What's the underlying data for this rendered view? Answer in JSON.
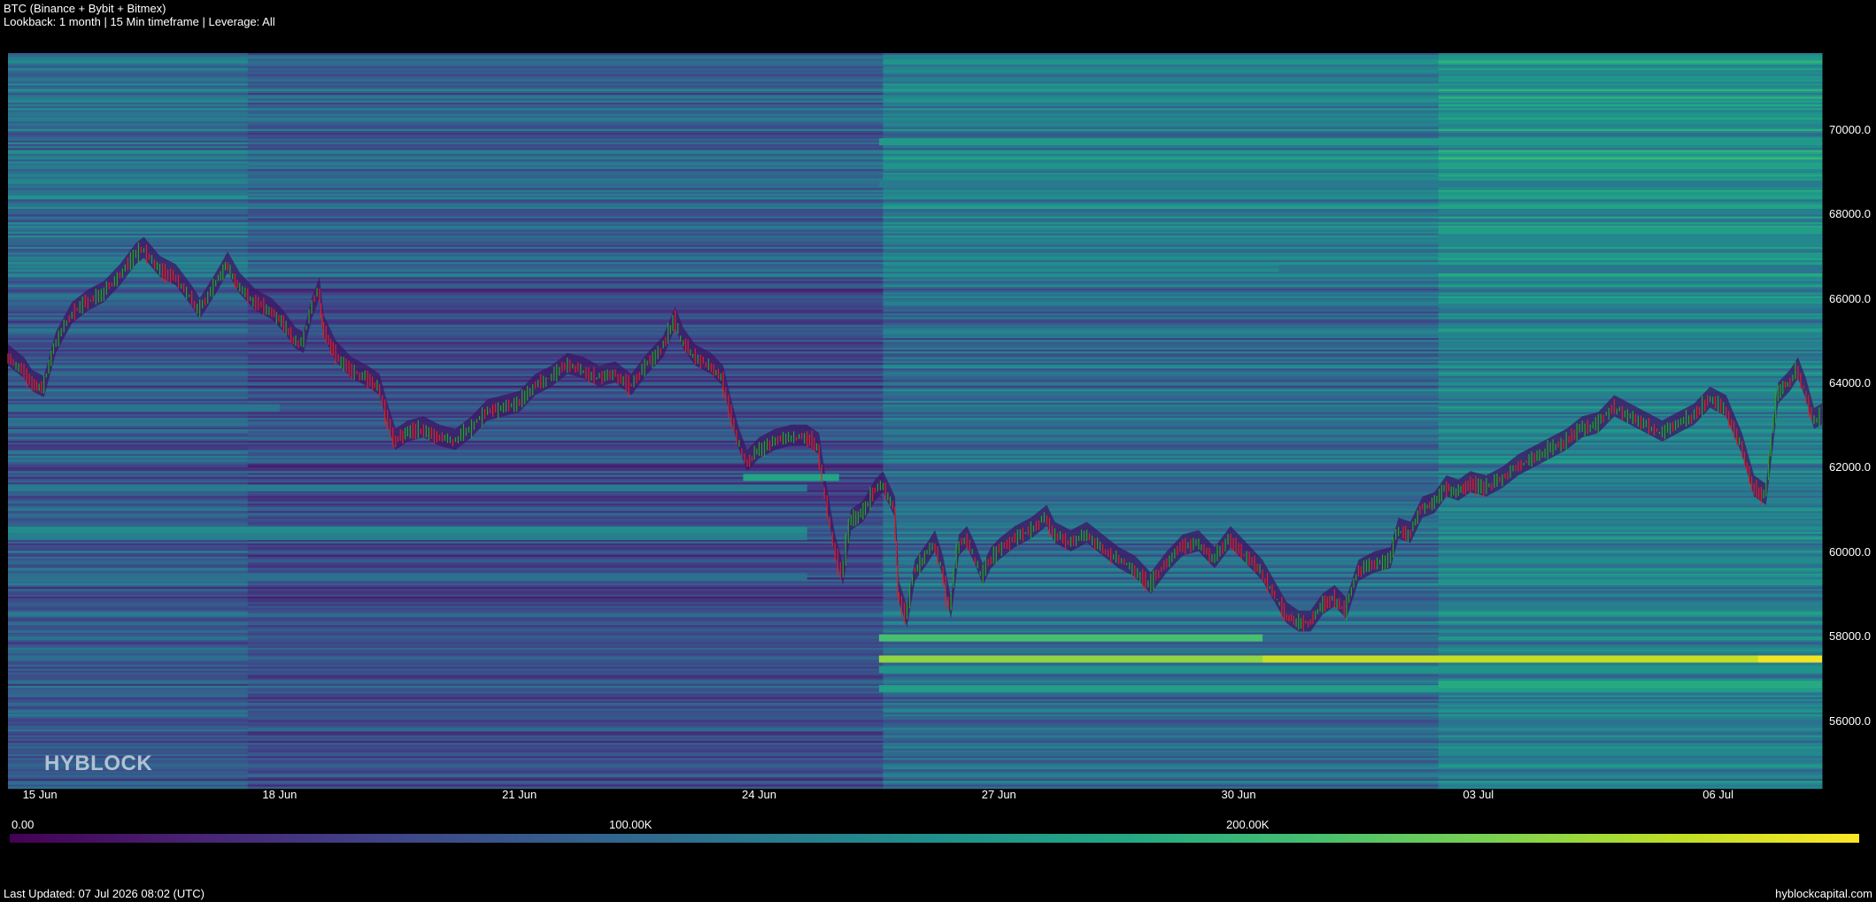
{
  "header": {
    "title": "BTC (Binance + Bybit + Bitmex)",
    "subtitle": "Lookback: 1 month | 15 Min timeframe | Leverage: All"
  },
  "watermark": "HYBLOCK",
  "footer": {
    "last_updated": "Last Updated: 07 Jul 2026 08:02 (UTC)",
    "site": "hyblockcapital.com"
  },
  "colorbar": {
    "labels": [
      "0.00",
      "100.00K",
      "200.00K"
    ],
    "min": 0,
    "max": 270000,
    "colormap": "viridis"
  },
  "chart_data": {
    "type": "heatmap",
    "subtype": "liquidation-heatmap-with-candles",
    "xlim_days": [
      14.6,
      37.3
    ],
    "ylim": [
      54400,
      71800
    ],
    "x_ticks": [
      {
        "day": 15,
        "label": "15 Jun"
      },
      {
        "day": 18,
        "label": "18 Jun"
      },
      {
        "day": 21,
        "label": "21 Jun"
      },
      {
        "day": 24,
        "label": "24 Jun"
      },
      {
        "day": 27,
        "label": "27 Jun"
      },
      {
        "day": 30,
        "label": "30 Jun"
      },
      {
        "day": 33,
        "label": "03 Jul"
      },
      {
        "day": 36,
        "label": "06 Jul"
      }
    ],
    "y_ticks": [
      56000,
      58000,
      60000,
      62000,
      64000,
      66000,
      68000,
      70000
    ],
    "y_tick_labels": [
      "56000.0",
      "58000.0",
      "60000.0",
      "62000.0",
      "64000.0",
      "66000.0",
      "68000.0",
      "70000.0"
    ],
    "bands": [
      {
        "price": 57450,
        "start_day": 25.5,
        "value": 225000
      },
      {
        "price": 57450,
        "start_day": 30.3,
        "value": 245000
      },
      {
        "price": 57450,
        "start_day": 36.5,
        "value": 265000
      },
      {
        "price": 57950,
        "start_day": 25.5,
        "end_day": 30.3,
        "value": 190000
      },
      {
        "price": 56750,
        "start_day": 25.5,
        "value": 150000
      },
      {
        "price": 56850,
        "start_day": 32.5,
        "value": 165000
      },
      {
        "price": 57200,
        "start_day": 25.5,
        "value": 140000
      },
      {
        "price": 61750,
        "start_day": 23.8,
        "end_day": 25.0,
        "value": 160000
      },
      {
        "price": 60500,
        "start_day": 14.6,
        "end_day": 24.6,
        "value": 130000
      },
      {
        "price": 60350,
        "start_day": 14.6,
        "end_day": 24.6,
        "value": 115000
      },
      {
        "price": 61500,
        "start_day": 14.6,
        "end_day": 24.6,
        "value": 110000
      },
      {
        "price": 69700,
        "start_day": 25.5,
        "value": 145000
      },
      {
        "price": 67600,
        "start_day": 32.5,
        "value": 150000
      },
      {
        "price": 67400,
        "start_day": 32.5,
        "value": 125000
      },
      {
        "price": 64900,
        "start_day": 32.5,
        "value": 115000
      },
      {
        "price": 68700,
        "start_day": 25.5,
        "value": 110000
      },
      {
        "price": 66700,
        "start_day": 30.5,
        "value": 105000
      },
      {
        "price": 63400,
        "start_day": 14.6,
        "end_day": 18.0,
        "value": 105000
      },
      {
        "price": 59400,
        "start_day": 14.6,
        "end_day": 24.6,
        "value": 100000
      }
    ],
    "price_path": [
      [
        14.6,
        64600
      ],
      [
        14.8,
        64300
      ],
      [
        14.9,
        64000
      ],
      [
        15.05,
        63850
      ],
      [
        15.2,
        64900
      ],
      [
        15.4,
        65600
      ],
      [
        15.6,
        65900
      ],
      [
        15.8,
        66100
      ],
      [
        16.0,
        66500
      ],
      [
        16.2,
        67000
      ],
      [
        16.3,
        67150
      ],
      [
        16.5,
        66700
      ],
      [
        16.7,
        66500
      ],
      [
        16.9,
        66000
      ],
      [
        17.0,
        65700
      ],
      [
        17.2,
        66300
      ],
      [
        17.35,
        66800
      ],
      [
        17.5,
        66300
      ],
      [
        17.7,
        65900
      ],
      [
        17.9,
        65700
      ],
      [
        18.05,
        65400
      ],
      [
        18.2,
        65000
      ],
      [
        18.3,
        64900
      ],
      [
        18.4,
        65700
      ],
      [
        18.5,
        66200
      ],
      [
        18.55,
        65300
      ],
      [
        18.7,
        64700
      ],
      [
        18.9,
        64300
      ],
      [
        19.1,
        64100
      ],
      [
        19.25,
        63900
      ],
      [
        19.35,
        63200
      ],
      [
        19.45,
        62600
      ],
      [
        19.6,
        62800
      ],
      [
        19.8,
        62900
      ],
      [
        20.0,
        62700
      ],
      [
        20.2,
        62600
      ],
      [
        20.4,
        62900
      ],
      [
        20.6,
        63300
      ],
      [
        20.8,
        63400
      ],
      [
        21.0,
        63500
      ],
      [
        21.2,
        63900
      ],
      [
        21.4,
        64100
      ],
      [
        21.6,
        64400
      ],
      [
        21.8,
        64300
      ],
      [
        22.0,
        64100
      ],
      [
        22.2,
        64200
      ],
      [
        22.4,
        63900
      ],
      [
        22.6,
        64400
      ],
      [
        22.8,
        64800
      ],
      [
        22.95,
        65500
      ],
      [
        23.05,
        65000
      ],
      [
        23.2,
        64600
      ],
      [
        23.4,
        64400
      ],
      [
        23.55,
        64100
      ],
      [
        23.65,
        63300
      ],
      [
        23.75,
        62600
      ],
      [
        23.85,
        62100
      ],
      [
        24.0,
        62400
      ],
      [
        24.2,
        62600
      ],
      [
        24.4,
        62700
      ],
      [
        24.6,
        62700
      ],
      [
        24.75,
        62500
      ],
      [
        24.85,
        61200
      ],
      [
        24.95,
        60100
      ],
      [
        25.05,
        59400
      ],
      [
        25.15,
        60700
      ],
      [
        25.3,
        60900
      ],
      [
        25.45,
        61400
      ],
      [
        25.55,
        61600
      ],
      [
        25.7,
        61000
      ],
      [
        25.75,
        59000
      ],
      [
        25.85,
        58400
      ],
      [
        25.95,
        59500
      ],
      [
        26.1,
        59900
      ],
      [
        26.2,
        60200
      ],
      [
        26.3,
        59600
      ],
      [
        26.4,
        58600
      ],
      [
        26.5,
        60100
      ],
      [
        26.6,
        60300
      ],
      [
        26.7,
        59900
      ],
      [
        26.8,
        59400
      ],
      [
        26.9,
        59800
      ],
      [
        27.0,
        60000
      ],
      [
        27.2,
        60300
      ],
      [
        27.4,
        60500
      ],
      [
        27.6,
        60800
      ],
      [
        27.7,
        60400
      ],
      [
        27.9,
        60200
      ],
      [
        28.1,
        60400
      ],
      [
        28.3,
        60100
      ],
      [
        28.5,
        59800
      ],
      [
        28.7,
        59600
      ],
      [
        28.9,
        59200
      ],
      [
        29.1,
        59700
      ],
      [
        29.3,
        60100
      ],
      [
        29.5,
        60200
      ],
      [
        29.7,
        59800
      ],
      [
        29.9,
        60300
      ],
      [
        30.1,
        59900
      ],
      [
        30.3,
        59500
      ],
      [
        30.45,
        59000
      ],
      [
        30.6,
        58500
      ],
      [
        30.75,
        58300
      ],
      [
        30.9,
        58300
      ],
      [
        31.05,
        58700
      ],
      [
        31.2,
        58900
      ],
      [
        31.35,
        58600
      ],
      [
        31.5,
        59500
      ],
      [
        31.7,
        59700
      ],
      [
        31.9,
        59800
      ],
      [
        32.0,
        60500
      ],
      [
        32.15,
        60400
      ],
      [
        32.3,
        61000
      ],
      [
        32.45,
        61100
      ],
      [
        32.6,
        61500
      ],
      [
        32.75,
        61400
      ],
      [
        32.9,
        61600
      ],
      [
        33.1,
        61500
      ],
      [
        33.3,
        61700
      ],
      [
        33.5,
        62000
      ],
      [
        33.7,
        62200
      ],
      [
        33.9,
        62400
      ],
      [
        34.1,
        62600
      ],
      [
        34.3,
        62900
      ],
      [
        34.5,
        63000
      ],
      [
        34.7,
        63400
      ],
      [
        34.9,
        63200
      ],
      [
        35.1,
        63000
      ],
      [
        35.3,
        62800
      ],
      [
        35.5,
        63000
      ],
      [
        35.7,
        63200
      ],
      [
        35.9,
        63600
      ],
      [
        36.1,
        63400
      ],
      [
        36.3,
        62500
      ],
      [
        36.45,
        61500
      ],
      [
        36.6,
        61300
      ],
      [
        36.75,
        63700
      ],
      [
        36.9,
        64000
      ],
      [
        37.0,
        64300
      ],
      [
        37.1,
        63800
      ],
      [
        37.2,
        63100
      ],
      [
        37.3,
        63200
      ]
    ]
  }
}
